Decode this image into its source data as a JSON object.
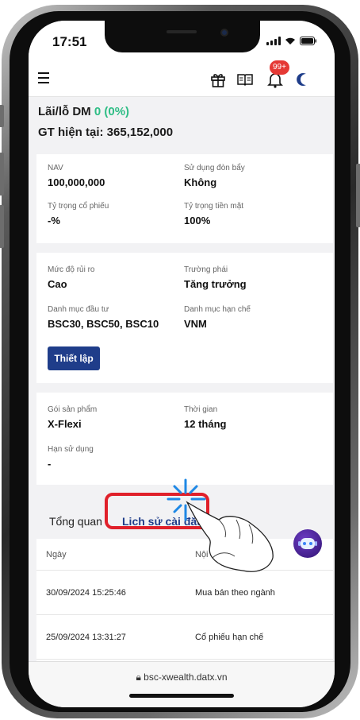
{
  "status_bar": {
    "time": "17:51"
  },
  "header": {
    "notification_count": "99+"
  },
  "summary": {
    "pl_label": "Lãi/lỗ DM",
    "pl_value": "0 (0%)",
    "current_value": "GT hiện tại: 365,152,000"
  },
  "card1": {
    "nav_label": "NAV",
    "nav_value": "100,000,000",
    "leverage_label": "Sử dụng đòn bẩy",
    "leverage_value": "Không",
    "stock_ratio_label": "Tỷ trọng cổ phiếu",
    "stock_ratio_value": "-%",
    "cash_ratio_label": "Tỷ trọng tiền mặt",
    "cash_ratio_value": "100%"
  },
  "card2": {
    "risk_label": "Mức độ rủi ro",
    "risk_value": "Cao",
    "style_label": "Trường phái",
    "style_value": "Tăng trưởng",
    "portfolio_label": "Danh mục đầu tư",
    "portfolio_value": "BSC30, BSC50, BSC10",
    "restricted_label": "Danh mục hạn chế",
    "restricted_value": "VNM",
    "setup_button": "Thiết lập"
  },
  "card3": {
    "package_label": "Gói sản phẩm",
    "package_value": "X-Flexi",
    "term_label": "Thời gian",
    "term_value": "12 tháng",
    "expiry_label": "Hạn sử dụng",
    "expiry_value": "-"
  },
  "tabs": [
    {
      "label": "Tổng quan"
    },
    {
      "label": "Lịch sử cài đặt"
    }
  ],
  "table": {
    "headers": [
      "Ngày",
      "Nội dung"
    ],
    "rows": [
      {
        "date": "30/09/2024 15:25:46",
        "content": "Mua bán theo ngành"
      },
      {
        "date": "25/09/2024 13:31:27",
        "content": "Cổ phiếu hạn chế"
      }
    ]
  },
  "browser": {
    "url": "bsc-xwealth.datx.vn"
  },
  "colors": {
    "brand": "#1f3d8a",
    "positive": "#2ebd85",
    "highlight": "#e0202a",
    "badge": "#e53935"
  }
}
